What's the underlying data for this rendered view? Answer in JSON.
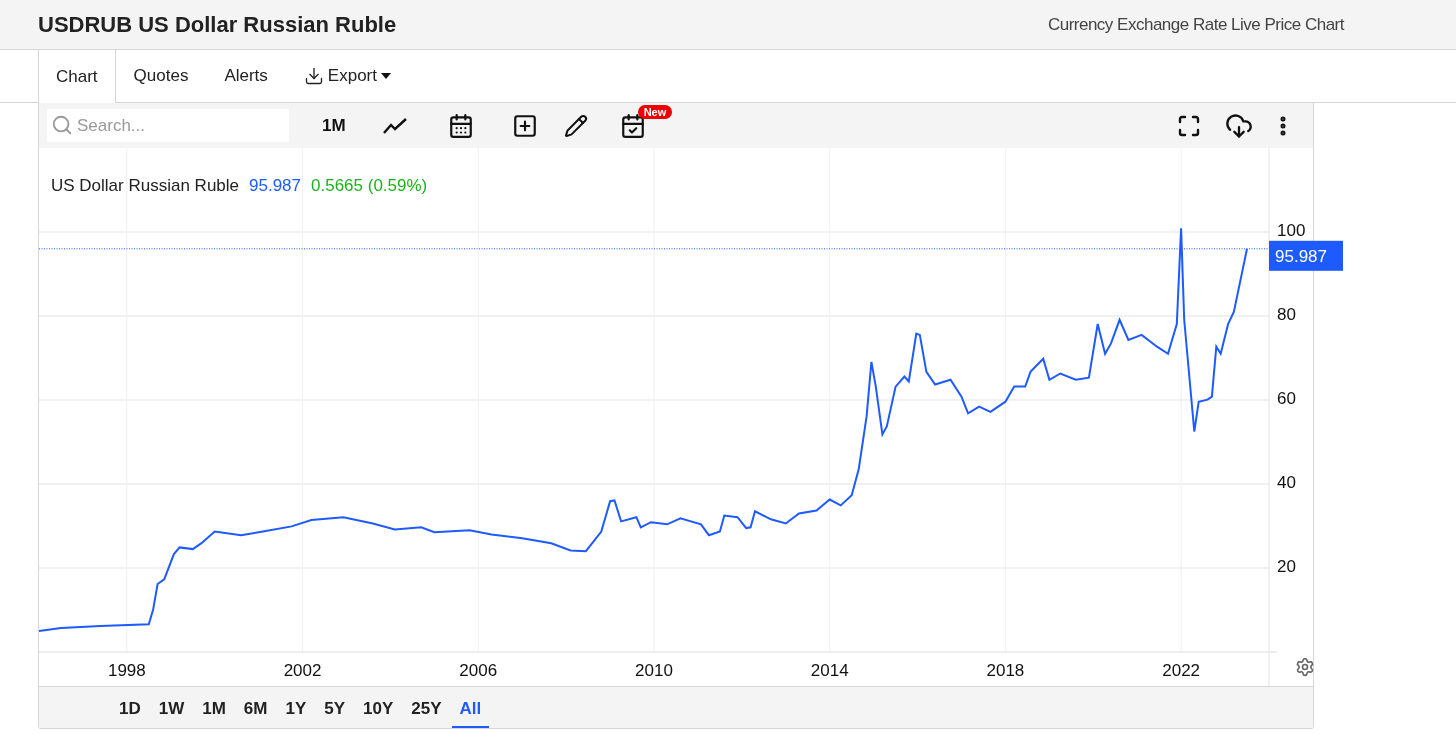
{
  "header": {
    "title": "USDRUB US Dollar Russian Ruble",
    "subtitle": "Currency Exchange Rate Live Price Chart"
  },
  "tabs": [
    {
      "label": "Chart",
      "kind": "tab",
      "selected": true
    },
    {
      "label": "Quotes",
      "kind": "tab",
      "selected": false
    },
    {
      "label": "Alerts",
      "kind": "tab",
      "selected": false
    },
    {
      "label": "Export",
      "kind": "menu",
      "selected": false
    }
  ],
  "toolbar": {
    "search_placeholder": "Search...",
    "period": "1M",
    "badge": "New"
  },
  "legend": {
    "price": "95.987",
    "change": "0.5665 (0.59%)"
  },
  "price_tag": "95.987",
  "chart_data": {
    "type": "line",
    "xlim": [
      1996,
      2024
    ],
    "ylim": [
      0,
      120
    ],
    "xticks": [
      1998,
      2002,
      2006,
      2010,
      2014,
      2018,
      2022
    ],
    "yticks": [
      20,
      40,
      60,
      80,
      100
    ],
    "grid": true,
    "ref_lines": [
      {
        "axis": "y",
        "value": 96.0
      }
    ],
    "x": [
      1996.0,
      1996.5,
      1997.4,
      1998.5,
      1998.6,
      1998.7,
      1998.85,
      1999.07,
      1999.2,
      1999.5,
      1999.7,
      2000.0,
      2000.6,
      2001.1,
      2001.75,
      2002.2,
      2002.93,
      2003.6,
      2004.1,
      2004.7,
      2005.0,
      2005.8,
      2006.3,
      2007.0,
      2007.66,
      2008.1,
      2008.45,
      2008.8,
      2009.0,
      2009.1,
      2009.25,
      2009.6,
      2009.7,
      2009.93,
      2010.3,
      2010.6,
      2011.07,
      2011.25,
      2011.5,
      2011.6,
      2011.9,
      2012.1,
      2012.2,
      2012.3,
      2012.66,
      2013.0,
      2013.3,
      2013.7,
      2014.0,
      2014.25,
      2014.5,
      2014.66,
      2014.84,
      2014.95,
      2015.05,
      2015.2,
      2015.3,
      2015.5,
      2015.7,
      2015.8,
      2015.97,
      2016.05,
      2016.2,
      2016.4,
      2016.75,
      2017.0,
      2017.15,
      2017.4,
      2017.66,
      2018.0,
      2018.2,
      2018.45,
      2018.57,
      2018.86,
      2019.0,
      2019.25,
      2019.6,
      2019.9,
      2020.1,
      2020.27,
      2020.4,
      2020.6,
      2020.8,
      2021.1,
      2021.45,
      2021.7,
      2021.9,
      2022.0,
      2022.07,
      2022.3,
      2022.4,
      2022.6,
      2022.7,
      2022.8,
      2022.9,
      2023.07,
      2023.2,
      2023.5
    ],
    "series": [
      {
        "name": "US Dollar Russian Ruble",
        "color": "#1e5bff",
        "values": [
          5.0,
          5.7,
          6.2,
          6.6,
          10.2,
          16.2,
          17.3,
          23.3,
          24.9,
          24.5,
          25.9,
          28.7,
          27.8,
          28.7,
          29.9,
          31.4,
          32.1,
          30.6,
          29.2,
          29.7,
          28.5,
          29.0,
          28.0,
          27.1,
          25.9,
          24.2,
          24.0,
          28.7,
          35.9,
          36.1,
          31.1,
          32.1,
          29.7,
          30.9,
          30.4,
          31.8,
          30.4,
          27.8,
          28.7,
          32.5,
          32.1,
          29.5,
          29.7,
          33.5,
          31.6,
          30.6,
          33.0,
          33.7,
          36.3,
          34.9,
          37.3,
          43.5,
          56.1,
          69.1,
          63.2,
          51.8,
          53.7,
          63.2,
          65.6,
          64.4,
          75.8,
          75.5,
          66.7,
          63.7,
          64.8,
          60.8,
          56.8,
          58.4,
          57.2,
          59.6,
          63.2,
          63.2,
          66.7,
          69.8,
          64.8,
          66.3,
          64.8,
          65.3,
          78.1,
          71.0,
          73.4,
          79.1,
          74.3,
          75.5,
          72.7,
          71.0,
          78.1,
          100.9,
          79.1,
          52.5,
          59.6,
          60.1,
          60.8,
          72.7,
          71.0,
          78.1,
          81.0,
          96.0
        ]
      }
    ]
  },
  "ranges": [
    {
      "label": "1D",
      "selected": false
    },
    {
      "label": "1W",
      "selected": false
    },
    {
      "label": "1M",
      "selected": false
    },
    {
      "label": "6M",
      "selected": false
    },
    {
      "label": "1Y",
      "selected": false
    },
    {
      "label": "5Y",
      "selected": false
    },
    {
      "label": "10Y",
      "selected": false
    },
    {
      "label": "25Y",
      "selected": false
    },
    {
      "label": "All",
      "selected": true
    }
  ]
}
